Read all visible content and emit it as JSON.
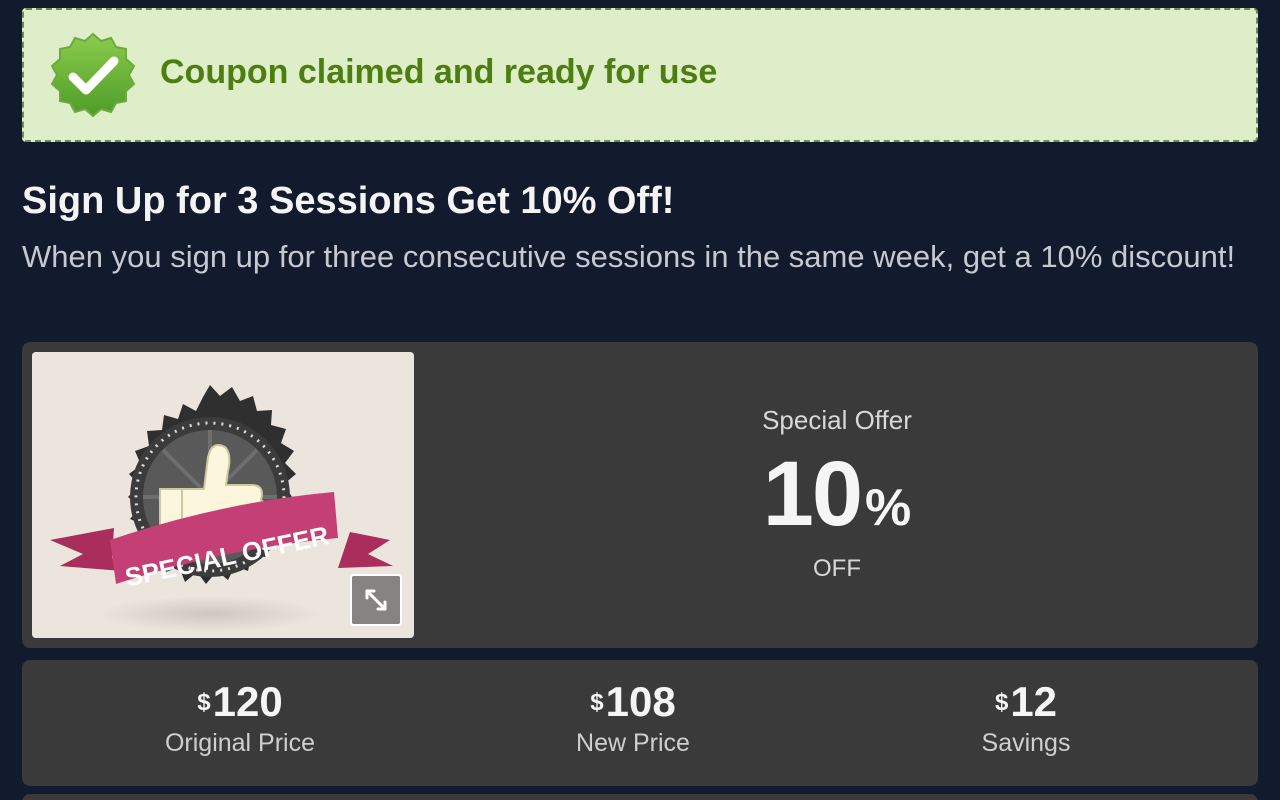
{
  "banner": {
    "message": "Coupon claimed and ready for use",
    "icon": "check-badge-icon",
    "background_color": "#ddeec8",
    "text_color": "#4e7d12"
  },
  "coupon": {
    "title": "Sign Up for 3 Sessions Get 10% Off!",
    "description": "When you sign up for three consecutive sessions in the same week, get a 10% discount!"
  },
  "offer": {
    "image_text": "SPECIAL OFFER",
    "label": "Special Offer",
    "value": "10",
    "unit": "%",
    "suffix": "OFF",
    "expand_icon": "expand-icon"
  },
  "pricing": [
    {
      "currency": "$",
      "value": "120",
      "label": "Original Price"
    },
    {
      "currency": "$",
      "value": "108",
      "label": "New Price"
    },
    {
      "currency": "$",
      "value": "12",
      "label": "Savings"
    }
  ],
  "colors": {
    "page_background": "#121a2e",
    "card_background": "#3a3a3a",
    "accent_ribbon": "#c33f74"
  }
}
